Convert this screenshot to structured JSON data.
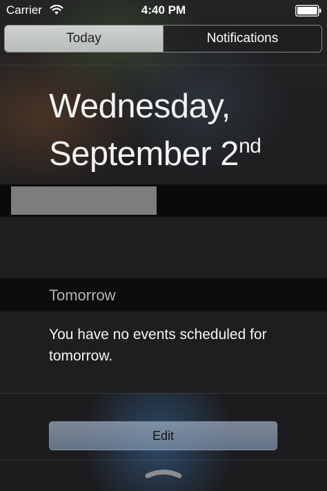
{
  "status_bar": {
    "carrier": "Carrier",
    "time": "4:40 PM",
    "wifi_icon": "wifi-icon",
    "battery_icon": "battery-full-icon"
  },
  "tabs": [
    {
      "label": "Today",
      "selected": true
    },
    {
      "label": "Notifications",
      "selected": false
    }
  ],
  "date": {
    "line1": "Wednesday,",
    "line2": "September 2",
    "suffix": "nd"
  },
  "tomorrow": {
    "title": "Tomorrow",
    "message": "You have no events scheduled for tomorrow."
  },
  "edit_label": "Edit",
  "colors": {
    "selected_tab": "#c6c9c7",
    "edit_button": "#8a9db5"
  }
}
